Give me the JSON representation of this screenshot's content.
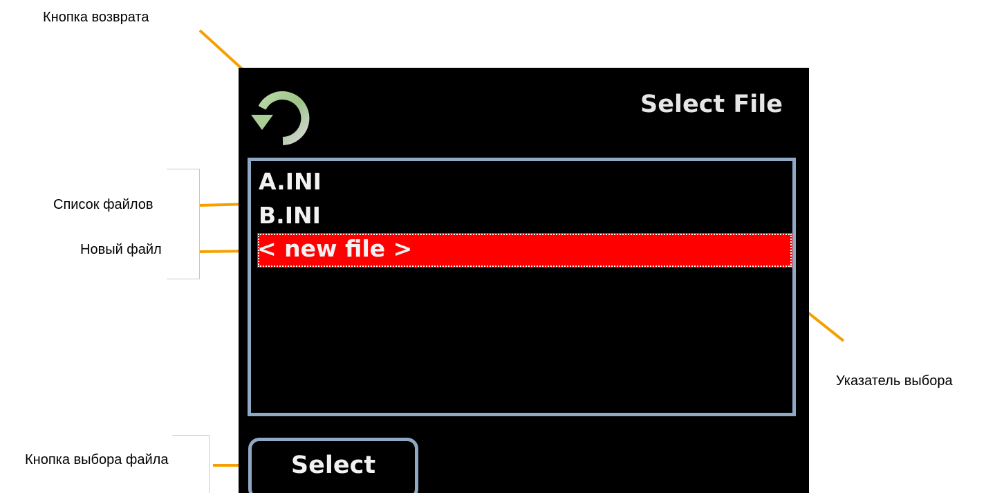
{
  "callouts": {
    "back_button": "Кнопка возврата",
    "file_list": "Список файлов",
    "new_file": "Новый файл",
    "selection_pointer": "Указатель выбора",
    "select_file_button": "Кнопка выбора файла"
  },
  "screen": {
    "title": "Select File",
    "back_icon": "rotate-back-icon",
    "files": [
      "A.INI",
      "B.INI"
    ],
    "new_file_label": "< new file >",
    "selected_index": 2,
    "select_button_label": "Select"
  },
  "colors": {
    "screen_background": "#000000",
    "frame_border": "#8fa8c4",
    "selection_highlight": "#ff0000",
    "leader_line": "#f5a000",
    "text": "#f2f2f2"
  }
}
